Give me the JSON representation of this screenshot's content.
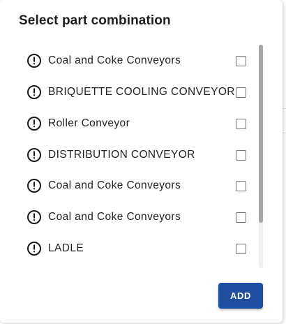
{
  "dialog": {
    "title": "Select part combination",
    "items": [
      {
        "label": "Coal and Coke Conveyors",
        "checked": false
      },
      {
        "label": "BRIQUETTE COOLING CONVEYOR",
        "checked": false
      },
      {
        "label": "Roller Conveyor",
        "checked": false
      },
      {
        "label": "DISTRIBUTION CONVEYOR",
        "checked": false
      },
      {
        "label": "Coal and Coke Conveyors",
        "checked": false
      },
      {
        "label": "Coal and Coke Conveyors",
        "checked": false
      },
      {
        "label": "LADLE",
        "checked": false
      }
    ],
    "item_icon": "exclamation-circle-icon",
    "add_label": "ADD",
    "colors": {
      "primary_button": "#1f4ea0",
      "text": "#222222",
      "checkbox_border": "#757575"
    }
  }
}
